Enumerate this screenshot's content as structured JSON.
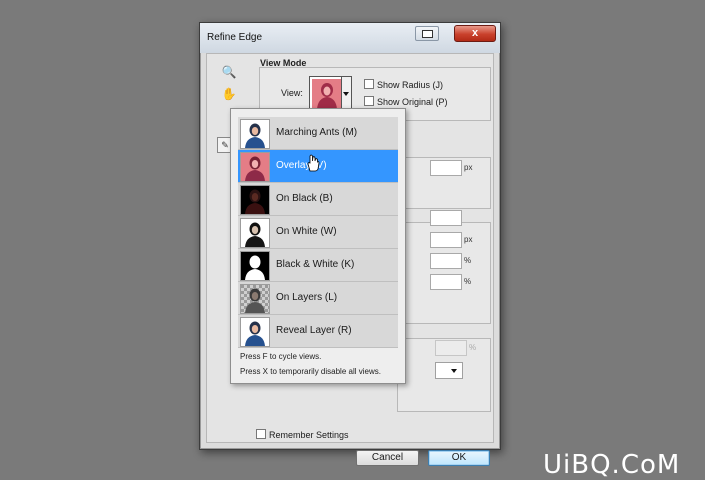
{
  "dialog": {
    "title": "Refine Edge",
    "close_label": "x",
    "view_mode": {
      "title": "View Mode",
      "view_label": "View:",
      "show_radius_label": "Show Radius (J)",
      "show_original_label": "Show Original (P)"
    },
    "units": [
      "px",
      "px",
      "%",
      "%",
      "%"
    ],
    "remember_label": "Remember Settings",
    "cancel_label": "Cancel",
    "ok_label": "OK"
  },
  "view_menu": {
    "items": [
      {
        "label": "Marching Ants (M)",
        "thumb": "marching-ants",
        "selected": false
      },
      {
        "label": "Overlay (V)",
        "thumb": "overlay",
        "selected": true
      },
      {
        "label": "On Black (B)",
        "thumb": "on-black",
        "selected": false
      },
      {
        "label": "On White (W)",
        "thumb": "on-white",
        "selected": false
      },
      {
        "label": "Black & White (K)",
        "thumb": "black-white",
        "selected": false
      },
      {
        "label": "On Layers (L)",
        "thumb": "on-layers",
        "selected": false
      },
      {
        "label": "Reveal Layer (R)",
        "thumb": "reveal-layer",
        "selected": false
      }
    ],
    "hint1": "Press F to cycle views.",
    "hint2": "Press X to temporarily disable all views."
  },
  "watermark": "UiBQ.CoM",
  "colors": {
    "selection": "#3496ff",
    "overlay_tint": "#e47d86"
  }
}
